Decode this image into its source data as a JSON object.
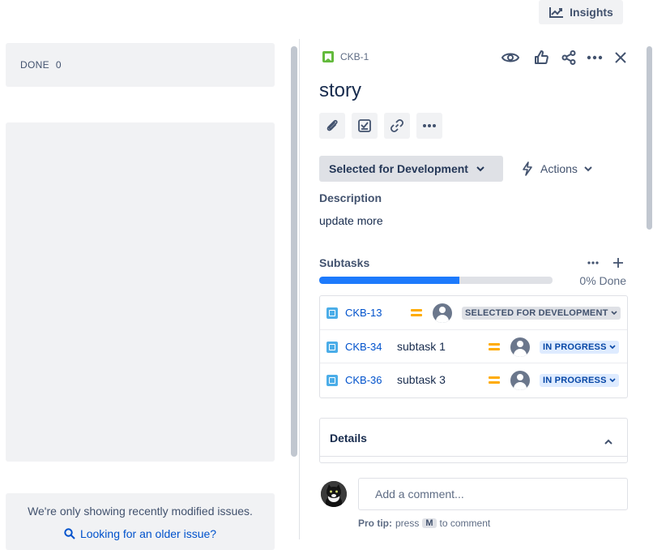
{
  "toolbar": {
    "insights_label": "Insights"
  },
  "board": {
    "done_column": {
      "label": "DONE",
      "count": "0"
    },
    "older_note": "We're only showing recently modified issues.",
    "older_link": "Looking for an older issue?"
  },
  "issue": {
    "key": "CKB-1",
    "type_icon": "story-icon",
    "title": "story",
    "status_label": "Selected for Development",
    "actions_label": "Actions",
    "description_heading": "Description",
    "description_text": "update more",
    "subtasks_heading": "Subtasks",
    "subtasks_progress": 0.6,
    "subtasks_done_label": "0% Done",
    "subtasks": [
      {
        "key": "CKB-13",
        "summary": "",
        "status": "SELECTED FOR DEVELOPMENT",
        "status_color": "#dfe1e6"
      },
      {
        "key": "CKB-34",
        "summary": "subtask 1",
        "status": "IN PROGRESS",
        "status_color": "#deebff"
      },
      {
        "key": "CKB-36",
        "summary": "subtask 3",
        "status": "IN PROGRESS",
        "status_color": "#deebff"
      }
    ],
    "details_heading": "Details",
    "comment_placeholder": "Add a comment...",
    "pro_tip_label": "Pro tip:",
    "pro_tip_press": "press",
    "pro_tip_key": "M",
    "pro_tip_suffix": "to comment"
  },
  "colors": {
    "accent": "#1d7afc",
    "link": "#0052cc",
    "priority_medium": "#ffab00",
    "story": "#63ba3c",
    "subtask": "#4bade8"
  }
}
